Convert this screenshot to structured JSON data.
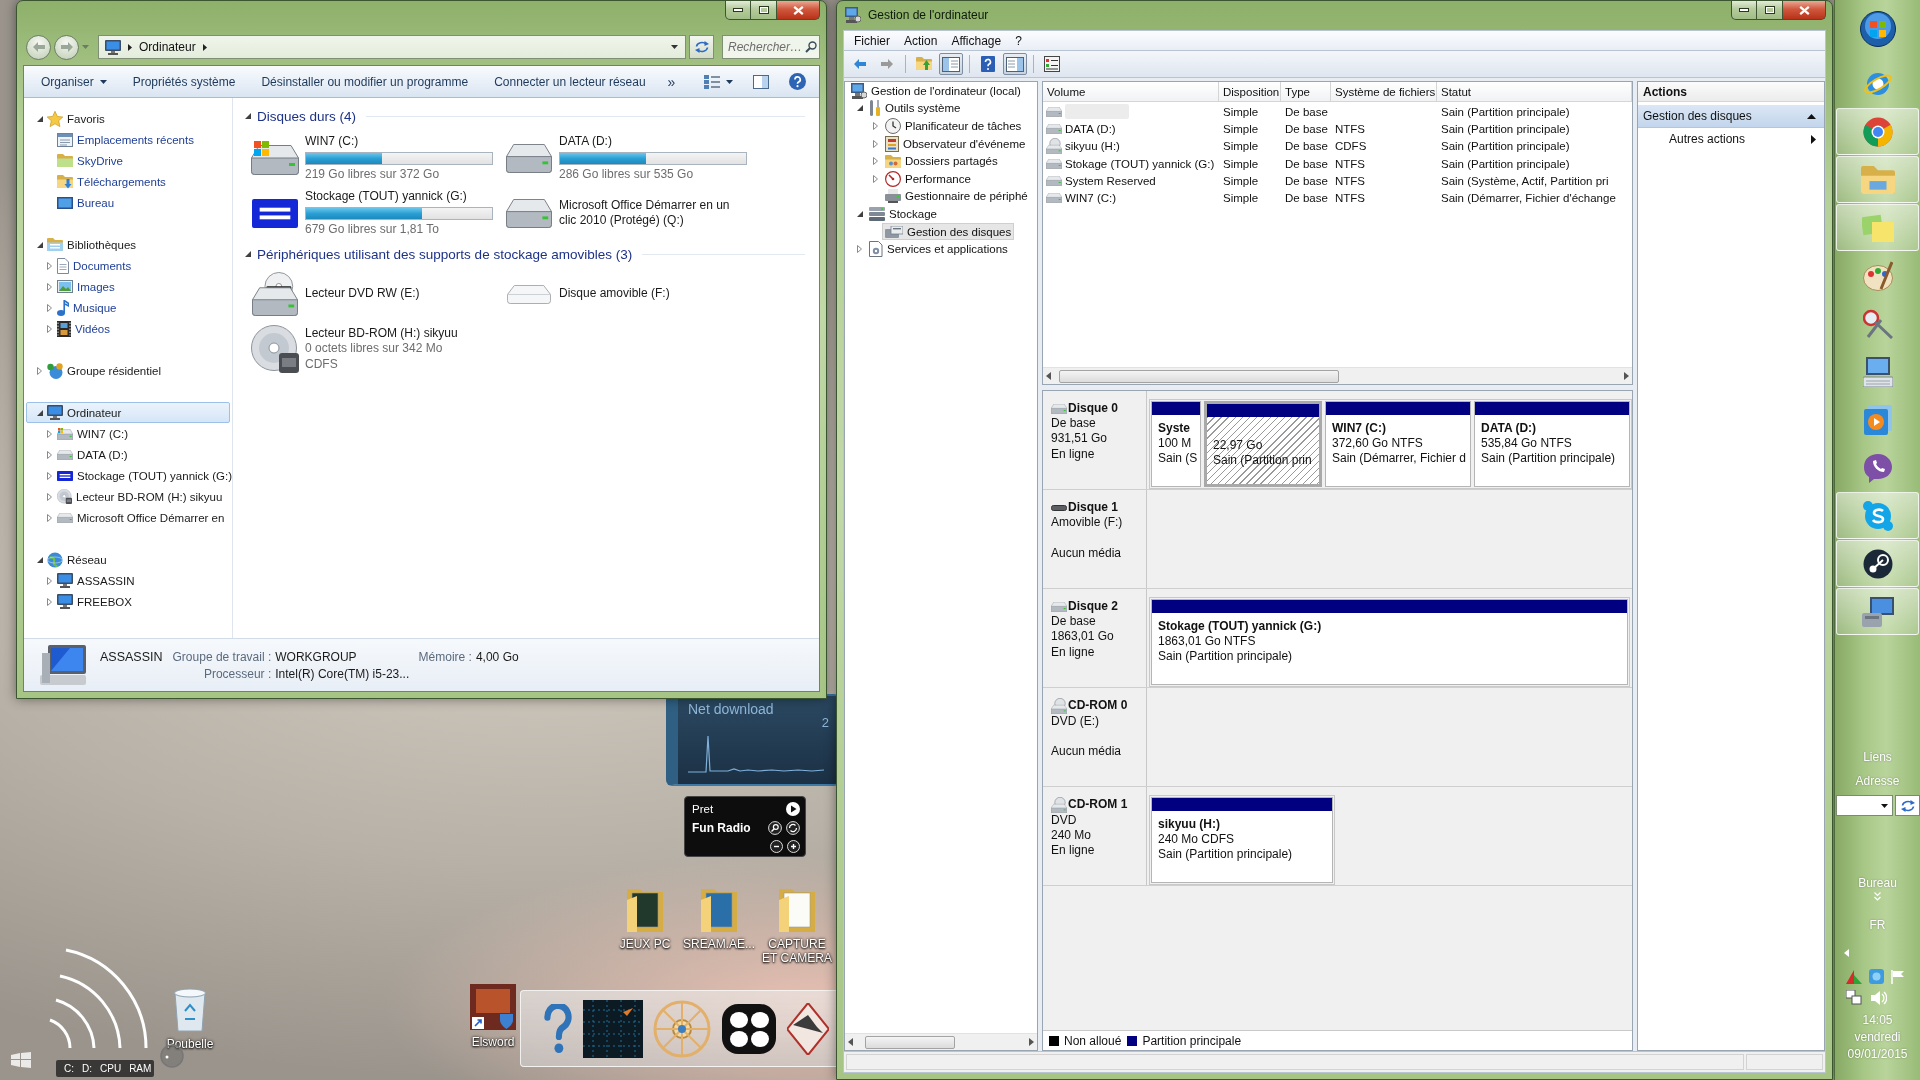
{
  "explorer": {
    "address": [
      "Ordinateur"
    ],
    "search": {
      "placeholder": "Rechercher…"
    },
    "commands": [
      {
        "label": "Organiser",
        "menu": true
      },
      {
        "label": "Propriétés système",
        "menu": false
      },
      {
        "label": "Désinstaller ou modifier un programme",
        "menu": false
      },
      {
        "label": "Connecter un lecteur réseau",
        "menu": false
      }
    ],
    "more": "»",
    "nav": [
      {
        "label": "Favoris",
        "expanded": true,
        "selected": false,
        "children": [
          {
            "label": "Emplacements récents",
            "selected": false
          },
          {
            "label": "SkyDrive",
            "selected": false
          },
          {
            "label": "Téléchargements",
            "selected": false
          },
          {
            "label": "Bureau",
            "selected": false
          }
        ]
      },
      {
        "label": "Bibliothèques",
        "expanded": true,
        "selected": false,
        "children": [
          {
            "label": "Documents",
            "expanded": false,
            "selected": false
          },
          {
            "label": "Images",
            "expanded": false,
            "selected": false
          },
          {
            "label": "Musique",
            "expanded": false,
            "selected": false
          },
          {
            "label": "Vidéos",
            "expanded": false,
            "selected": false
          }
        ]
      },
      {
        "label": "Groupe résidentiel",
        "expanded": false,
        "selected": false
      },
      {
        "label": "Ordinateur",
        "expanded": true,
        "selected": true,
        "children": [
          {
            "label": "WIN7 (C:)",
            "expanded": false,
            "selected": false
          },
          {
            "label": "DATA (D:)",
            "expanded": false,
            "selected": false
          },
          {
            "label": "Stockage (TOUT) yannick (G:)",
            "expanded": false,
            "selected": false
          },
          {
            "label": "Lecteur BD-ROM (H:) sikyuu",
            "expanded": false,
            "selected": false
          },
          {
            "label": "Microsoft Office Démarrer en",
            "expanded": false,
            "selected": false
          }
        ]
      },
      {
        "label": "Réseau",
        "expanded": true,
        "selected": false,
        "children": [
          {
            "label": "ASSASSIN",
            "expanded": false,
            "selected": false
          },
          {
            "label": "FREEBOX",
            "expanded": false,
            "selected": false
          }
        ]
      }
    ],
    "groups": [
      {
        "title": "Disques durs (4)",
        "expanded": true,
        "items": [
          {
            "name": "WIN7 (C:)",
            "level": 0.41,
            "detail": "219 Go libres sur 372 Go"
          },
          {
            "name": "DATA (D:)",
            "level": 0.465,
            "detail": "286 Go libres sur 535 Go"
          },
          {
            "name": "Stockage (TOUT) yannick (G:)",
            "level": 0.625,
            "detail": "679 Go libres sur 1,81 To"
          },
          {
            "name": "Microsoft Office Démarrer en un clic 2010 (Protégé) (Q:)"
          }
        ]
      },
      {
        "title": "Périphériques utilisant des supports de stockage amovibles (3)",
        "expanded": true,
        "items": [
          {
            "name": "Lecteur DVD RW (E:)"
          },
          {
            "name": "Disque amovible (F:)"
          },
          {
            "name": "Lecteur BD-ROM (H:) sikyuu",
            "detail": "0 octets libres sur 342 Mo",
            "extra": "CDFS"
          }
        ]
      }
    ],
    "details": {
      "name": "ASSASSIN",
      "fields": [
        {
          "label": "Groupe de travail :",
          "value": "WORKGROUP"
        },
        {
          "label": "Mémoire :",
          "value": "4,00 Go"
        },
        {
          "label": "Processeur :",
          "value": "Intel(R) Core(TM) i5-23..."
        }
      ]
    }
  },
  "management": {
    "title": "Gestion de l'ordinateur",
    "menu": [
      "Fichier",
      "Action",
      "Affichage",
      "?"
    ],
    "toolbar": [
      {
        "pressed": false
      },
      {
        "pressed": false
      },
      {
        "pressed": false
      },
      {
        "pressed": true
      },
      {
        "pressed": false
      },
      {
        "pressed": true
      },
      {
        "pressed": false
      }
    ],
    "tree": {
      "label": "Gestion de l'ordinateur (local)",
      "selected": false,
      "children": [
        {
          "label": "Outils système",
          "expanded": true,
          "selected": false,
          "children": [
            {
              "label": "Planificateur de tâches",
              "expanded": false,
              "selected": false
            },
            {
              "label": "Observateur d'événeme",
              "expanded": false,
              "selected": false
            },
            {
              "label": "Dossiers partagés",
              "expanded": false,
              "selected": false
            },
            {
              "label": "Performance",
              "expanded": false,
              "selected": false
            },
            {
              "label": "Gestionnaire de périphé",
              "selected": false
            }
          ]
        },
        {
          "label": "Stockage",
          "expanded": true,
          "selected": false,
          "children": [
            {
              "label": "Gestion des disques",
              "selected": true
            }
          ]
        },
        {
          "label": "Services et applications",
          "expanded": false,
          "selected": false
        }
      ]
    },
    "volumes": {
      "columns": [
        "Volume",
        "Disposition",
        "Type",
        "Système de fichiers",
        "Statut"
      ],
      "rows": [
        {
          "redacted": true,
          "layout": "Simple",
          "type": "De base",
          "status": "Sain (Partition principale)"
        },
        {
          "redacted": false,
          "volume": "DATA (D:)",
          "layout": "Simple",
          "type": "De base",
          "file_system": "NTFS",
          "status": "Sain (Partition principale)"
        },
        {
          "redacted": false,
          "volume": "sikyuu (H:)",
          "layout": "Simple",
          "type": "De base",
          "file_system": "CDFS",
          "status": "Sain (Partition principale)"
        },
        {
          "redacted": false,
          "volume": "Stokage (TOUT) yannick (G:)",
          "layout": "Simple",
          "type": "De base",
          "file_system": "NTFS",
          "status": "Sain (Partition principale)"
        },
        {
          "redacted": false,
          "volume": "System Reserved",
          "layout": "Simple",
          "type": "De base",
          "file_system": "NTFS",
          "status": "Sain (Système, Actif, Partition pri"
        },
        {
          "redacted": false,
          "volume": "WIN7 (C:)",
          "layout": "Simple",
          "type": "De base",
          "file_system": "NTFS",
          "status": "Sain (Démarrer, Fichier d'échange"
        }
      ]
    },
    "disks": [
      {
        "name": "Disque 0",
        "type": "De base",
        "size": "931,51 Go",
        "status": "En ligne",
        "partitions": [
          {
            "kind": "primary",
            "name": "Syste",
            "size": "100 M",
            "status": "Sain (S",
            "selected": false
          },
          {
            "kind": "primary",
            "size": "22,97 Go",
            "status": "Sain (Partition prin",
            "selected": true
          },
          {
            "kind": "primary",
            "name": "WIN7 (C:)",
            "size": "372,60 Go NTFS",
            "status": "Sain (Démarrer, Fichier d",
            "selected": false
          },
          {
            "kind": "primary",
            "name": "DATA (D:)",
            "size": "535,84 Go NTFS",
            "status": "Sain (Partition principale)",
            "selected": false
          }
        ]
      },
      {
        "name": "Disque 1",
        "type": "Amovible (F:)",
        "status": "Aucun média"
      },
      {
        "name": "Disque 2",
        "type": "De base",
        "size": "1863,01 Go",
        "status": "En ligne",
        "partitions": [
          {
            "kind": "primary",
            "name": "Stokage (TOUT) yannick (G:)",
            "size": "1863,01 Go NTFS",
            "status": "Sain (Partition principale)",
            "selected": false
          }
        ]
      },
      {
        "name": "CD-ROM 0",
        "type": "DVD (E:)",
        "status": "Aucun média"
      },
      {
        "name": "CD-ROM 1",
        "type": "DVD",
        "size": "240 Mo",
        "status": "En ligne",
        "partitions": [
          {
            "kind": "primary",
            "name": "sikyuu (H:)",
            "size": "240 Mo CDFS",
            "status": "Sain (Partition principale)",
            "selected": false
          }
        ]
      }
    ],
    "legend": [
      {
        "label": "Non alloué",
        "color": "#000000"
      },
      {
        "label": "Partition principale",
        "color": "#000080"
      }
    ],
    "actions": {
      "title": "Actions",
      "section": {
        "label": "Gestion des disques",
        "expanded": true
      },
      "items": [
        "Autres actions"
      ]
    }
  },
  "desktop": {
    "shortcuts": [
      {
        "label": "JEUX PC"
      },
      {
        "label": "SREAM.AE..."
      },
      {
        "label": "CAPTURE ET CAMERA"
      },
      {
        "label": "Elsword"
      },
      {
        "label": "Poubelle"
      }
    ],
    "net_gadget": {
      "title": "Net download",
      "reading": "2"
    },
    "radio_gadget": {
      "status": "Pret",
      "station": "Fun Radio"
    },
    "meter_gadget": {
      "labels": [
        "C:",
        "D:",
        "CPU",
        "RAM"
      ]
    }
  },
  "taskbar": {
    "buttons": [
      {
        "running": false
      },
      {
        "running": false
      },
      {
        "running": true
      },
      {
        "running": true
      },
      {
        "running": true
      },
      {
        "running": false
      },
      {
        "running": false
      },
      {
        "running": false
      },
      {
        "running": false
      },
      {
        "running": false
      },
      {
        "running": true
      },
      {
        "running": true
      },
      {
        "running": true
      }
    ],
    "links": "Liens",
    "address": "Adresse",
    "desktop": "Bureau",
    "language": "FR",
    "clock": {
      "time": "14:05",
      "day": "vendredi",
      "date": "09/01/2015"
    }
  }
}
